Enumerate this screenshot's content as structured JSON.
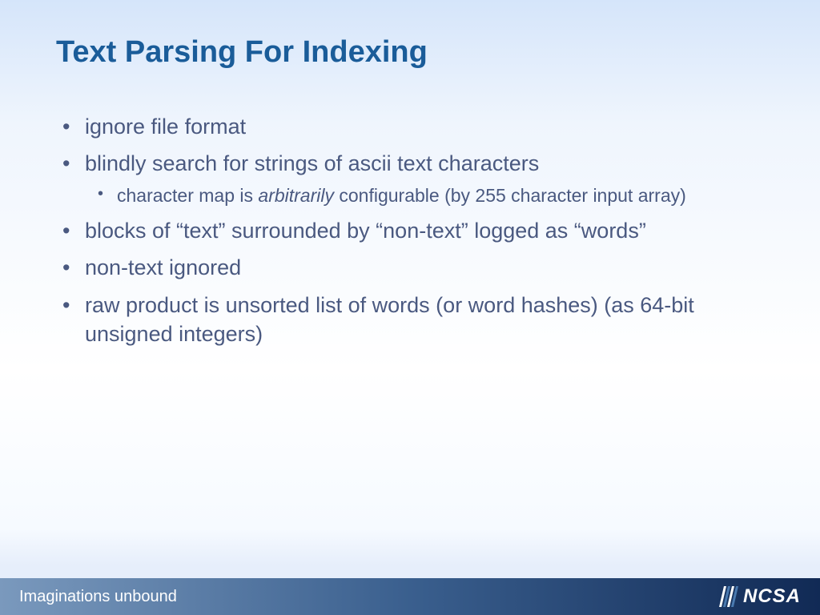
{
  "title": "Text Parsing For Indexing",
  "bullets": [
    {
      "text": "ignore file format"
    },
    {
      "text": "blindly search for strings of ascii text characters",
      "sub": [
        {
          "pre": "character map is ",
          "em": "arbitrarily",
          "post": " configurable (by 255 character input array)"
        }
      ]
    },
    {
      "text": "blocks of “text” surrounded by “non-text” logged as “words”"
    },
    {
      "text": "non-text ignored"
    },
    {
      "text": "raw product is unsorted list of words (or word hashes) (as 64-bit unsigned integers)"
    }
  ],
  "footer": {
    "tagline": "Imaginations unbound",
    "logo_text": "NCSA"
  }
}
